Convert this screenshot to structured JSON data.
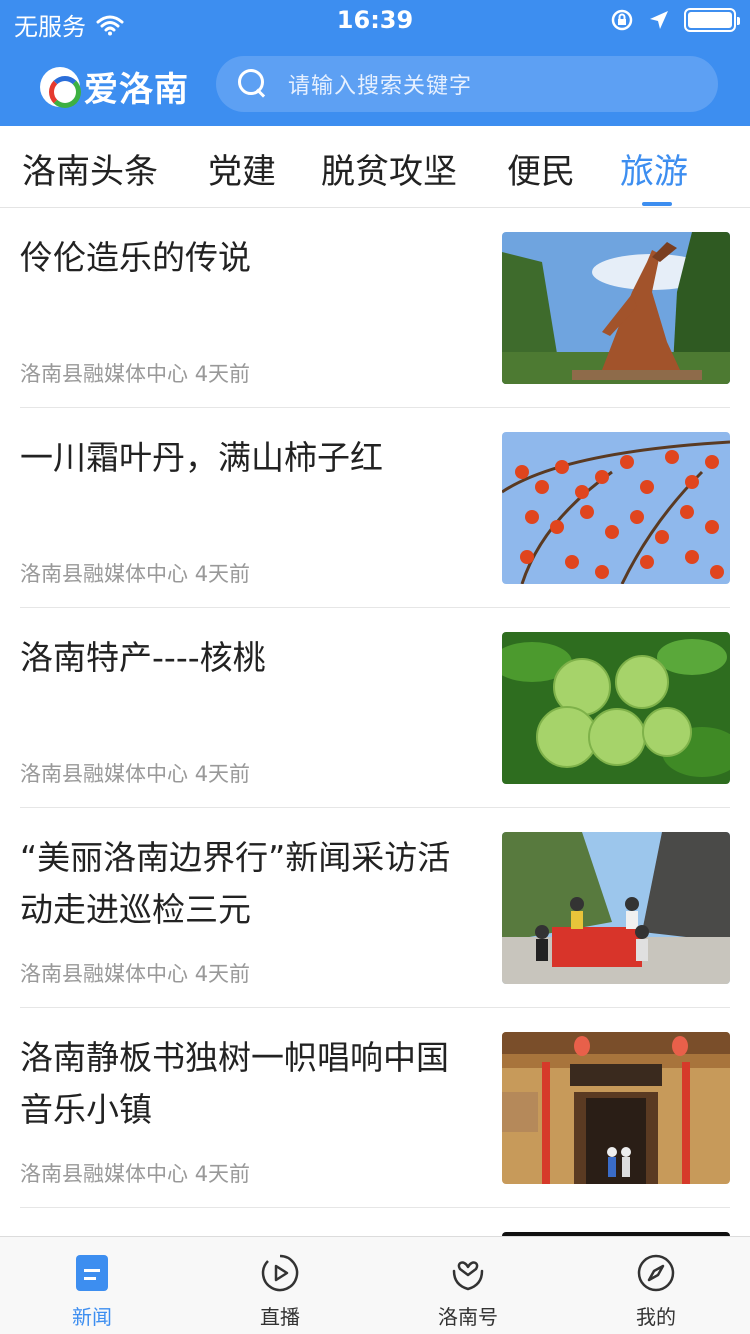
{
  "status_bar": {
    "carrier": "无服务",
    "time": "16:39"
  },
  "header": {
    "app_name": "爱洛南",
    "search_placeholder": "请输入搜索关键字"
  },
  "tabs": [
    {
      "label": "洛南头条",
      "active": false
    },
    {
      "label": "党建",
      "active": false
    },
    {
      "label": "脱贫攻坚",
      "active": false
    },
    {
      "label": "便民",
      "active": false
    },
    {
      "label": "旅游",
      "active": true
    }
  ],
  "news": [
    {
      "title": "伶伦造乐的传说",
      "source": "洛南县融媒体中心",
      "time": "4天前",
      "image": "statue-photo"
    },
    {
      "title": "一川霜叶丹，满山柿子红",
      "source": "洛南县融媒体中心",
      "time": "4天前",
      "image": "persimmon-photo"
    },
    {
      "title": "洛南特产----核桃",
      "source": "洛南县融媒体中心",
      "time": "4天前",
      "image": "walnut-photo"
    },
    {
      "title": "“美丽洛南边界行”新闻采访活动走进巡检三元",
      "source": "洛南县融媒体中心",
      "time": "4天前",
      "image": "group-banner-photo"
    },
    {
      "title": "洛南静板书独树一帜唱响中国音乐小镇",
      "source": "洛南县融媒体中心",
      "time": "4天前",
      "image": "building-photo"
    }
  ],
  "tabbar": [
    {
      "label": "新闻",
      "icon": "news-icon",
      "active": true
    },
    {
      "label": "直播",
      "icon": "play-icon",
      "active": false
    },
    {
      "label": "洛南号",
      "icon": "heart-person-icon",
      "active": false
    },
    {
      "label": "我的",
      "icon": "compass-icon",
      "active": false
    }
  ],
  "colors": {
    "primary": "#3d8ef0",
    "text": "#222222",
    "meta": "#999999"
  }
}
